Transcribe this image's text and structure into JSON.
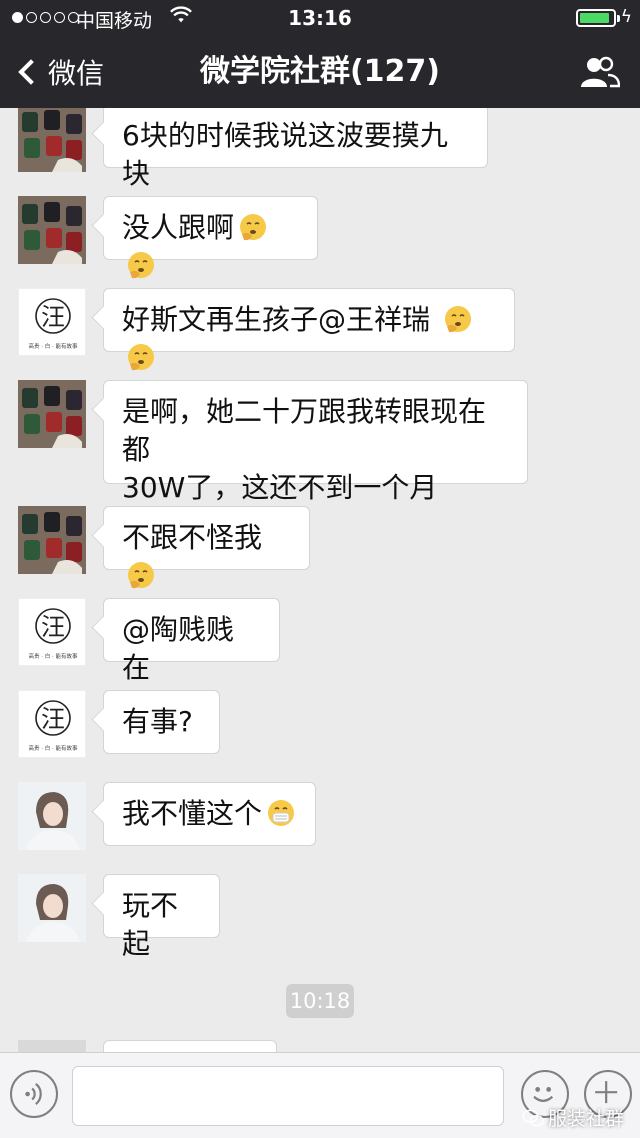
{
  "status_bar": {
    "carrier": "中国移动",
    "time": "13:16",
    "battery_level": 0.9,
    "signal_bars": 1
  },
  "nav": {
    "back_label": "微信",
    "title": "微学院社群(127)"
  },
  "messages": [
    {
      "avatar": "jackets",
      "text": "6块的时候我说这波要摸九块",
      "emoji": 0
    },
    {
      "avatar": "jackets",
      "text": "没人跟啊",
      "emoji": 2
    },
    {
      "avatar": "wang",
      "text": "好斯文再生孩子@王祥瑞 ",
      "emoji": 2
    },
    {
      "avatar": "jackets",
      "text": "是啊，她二十万跟我转眼现在都",
      "text2": "30W了，这还不到一个月",
      "emoji": 0
    },
    {
      "avatar": "jackets",
      "text": "不跟不怪我",
      "emoji": 1
    },
    {
      "avatar": "wang",
      "text": "@陶贱贱 在",
      "emoji": 0
    },
    {
      "avatar": "wang",
      "text": "有事?",
      "emoji": 0
    },
    {
      "avatar": "girl",
      "text": "我不懂这个",
      "emoji": 1,
      "emoji_type": "mask"
    },
    {
      "avatar": "girl",
      "text": "玩不起",
      "emoji": 0
    }
  ],
  "time_divider": "10:18",
  "avatar_wang_char": "汪",
  "avatar_wang_caption": "高贵 · 白 · 能有故事",
  "input": {
    "placeholder": ""
  },
  "watermark": "服装社群",
  "colors": {
    "nav_bg": "#27272c",
    "chat_bg": "#ebebeb",
    "battery": "#4cd964",
    "emoji_face": "#f7c948"
  },
  "icons": {
    "voice": "voice-icon",
    "emoji": "smiley-icon",
    "more": "plus-icon",
    "group": "group-members-icon"
  }
}
